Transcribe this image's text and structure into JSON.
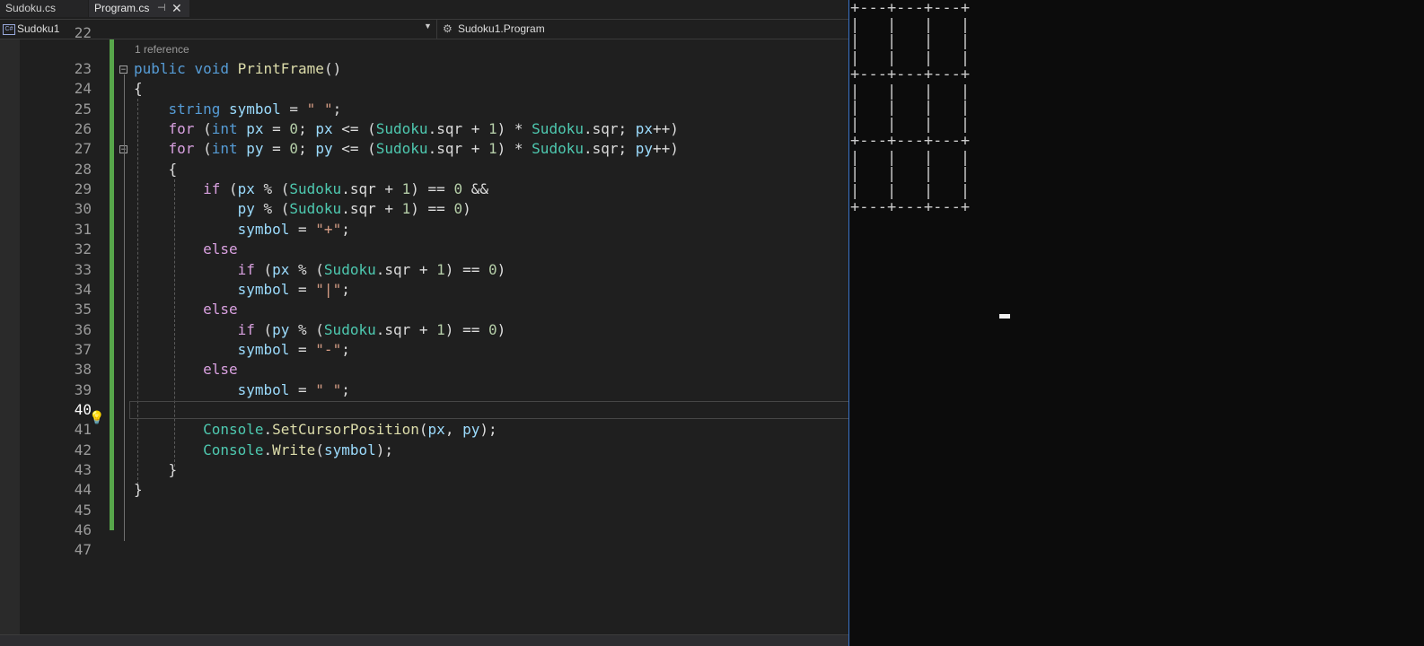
{
  "tabs": [
    {
      "label": "Sudoku.cs",
      "active": false
    },
    {
      "label": "Program.cs",
      "active": true
    }
  ],
  "navbar": {
    "project": "Sudoku1",
    "project_icon": "csharp-project-icon",
    "member": "Sudoku1.Program",
    "member_icon": "class-icon"
  },
  "codelens": "1 reference",
  "line_numbers": [
    "22",
    "23",
    "24",
    "25",
    "26",
    "27",
    "28",
    "29",
    "30",
    "31",
    "32",
    "33",
    "34",
    "35",
    "36",
    "37",
    "38",
    "39",
    "40",
    "41",
    "42",
    "43",
    "44",
    "45",
    "46",
    "47"
  ],
  "current_line": "40",
  "code_lines": [
    {
      "ln": "23",
      "segs": [
        [
          "kw",
          "public"
        ],
        [
          "pun",
          " "
        ],
        [
          "kw",
          "void"
        ],
        [
          "pun",
          " "
        ],
        [
          "fn",
          "PrintFrame"
        ],
        [
          "pun",
          "()"
        ]
      ]
    },
    {
      "ln": "24",
      "segs": [
        [
          "pun",
          "{"
        ]
      ]
    },
    {
      "ln": "25",
      "segs": [
        [
          "pun",
          "    "
        ],
        [
          "kw",
          "string"
        ],
        [
          "pun",
          " "
        ],
        [
          "var",
          "symbol"
        ],
        [
          "pun",
          " = "
        ],
        [
          "str",
          "\" \""
        ],
        [
          "pun",
          ";"
        ]
      ]
    },
    {
      "ln": "26",
      "segs": [
        [
          "pun",
          "    "
        ],
        [
          "ctl",
          "for"
        ],
        [
          "pun",
          " ("
        ],
        [
          "kw",
          "int"
        ],
        [
          "pun",
          " "
        ],
        [
          "var",
          "px"
        ],
        [
          "pun",
          " = "
        ],
        [
          "num",
          "0"
        ],
        [
          "pun",
          "; "
        ],
        [
          "var",
          "px"
        ],
        [
          "pun",
          " <= ("
        ],
        [
          "ty",
          "Sudoku"
        ],
        [
          "pun",
          "."
        ],
        [
          "pun",
          "sqr + "
        ],
        [
          "num",
          "1"
        ],
        [
          "pun",
          ") * "
        ],
        [
          "ty",
          "Sudoku"
        ],
        [
          "pun",
          ".sqr; "
        ],
        [
          "var",
          "px"
        ],
        [
          "pun",
          "++)"
        ]
      ]
    },
    {
      "ln": "27",
      "segs": [
        [
          "pun",
          "    "
        ],
        [
          "ctl",
          "for"
        ],
        [
          "pun",
          " ("
        ],
        [
          "kw",
          "int"
        ],
        [
          "pun",
          " "
        ],
        [
          "var",
          "py"
        ],
        [
          "pun",
          " = "
        ],
        [
          "num",
          "0"
        ],
        [
          "pun",
          "; "
        ],
        [
          "var",
          "py"
        ],
        [
          "pun",
          " <= ("
        ],
        [
          "ty",
          "Sudoku"
        ],
        [
          "pun",
          "."
        ],
        [
          "pun",
          "sqr + "
        ],
        [
          "num",
          "1"
        ],
        [
          "pun",
          ") * "
        ],
        [
          "ty",
          "Sudoku"
        ],
        [
          "pun",
          ".sqr; "
        ],
        [
          "var",
          "py"
        ],
        [
          "pun",
          "++)"
        ]
      ]
    },
    {
      "ln": "28",
      "segs": [
        [
          "pun",
          "    {"
        ]
      ]
    },
    {
      "ln": "29",
      "segs": [
        [
          "pun",
          "        "
        ],
        [
          "ctl",
          "if"
        ],
        [
          "pun",
          " ("
        ],
        [
          "var",
          "px"
        ],
        [
          "pun",
          " % ("
        ],
        [
          "ty",
          "Sudoku"
        ],
        [
          "pun",
          ".sqr + "
        ],
        [
          "num",
          "1"
        ],
        [
          "pun",
          ") == "
        ],
        [
          "num",
          "0"
        ],
        [
          "pun",
          " &&"
        ]
      ]
    },
    {
      "ln": "30",
      "segs": [
        [
          "pun",
          "            "
        ],
        [
          "var",
          "py"
        ],
        [
          "pun",
          " % ("
        ],
        [
          "ty",
          "Sudoku"
        ],
        [
          "pun",
          ".sqr + "
        ],
        [
          "num",
          "1"
        ],
        [
          "pun",
          ") == "
        ],
        [
          "num",
          "0"
        ],
        [
          "pun",
          ")"
        ]
      ]
    },
    {
      "ln": "31",
      "segs": [
        [
          "pun",
          "            "
        ],
        [
          "var",
          "symbol"
        ],
        [
          "pun",
          " = "
        ],
        [
          "str",
          "\"+\""
        ],
        [
          "pun",
          ";"
        ]
      ]
    },
    {
      "ln": "32",
      "segs": [
        [
          "pun",
          "        "
        ],
        [
          "ctl",
          "else"
        ]
      ]
    },
    {
      "ln": "33",
      "segs": [
        [
          "pun",
          "            "
        ],
        [
          "ctl",
          "if"
        ],
        [
          "pun",
          " ("
        ],
        [
          "var",
          "px"
        ],
        [
          "pun",
          " % ("
        ],
        [
          "ty",
          "Sudoku"
        ],
        [
          "pun",
          ".sqr + "
        ],
        [
          "num",
          "1"
        ],
        [
          "pun",
          ") == "
        ],
        [
          "num",
          "0"
        ],
        [
          "pun",
          ")"
        ]
      ]
    },
    {
      "ln": "34",
      "segs": [
        [
          "pun",
          "            "
        ],
        [
          "var",
          "symbol"
        ],
        [
          "pun",
          " = "
        ],
        [
          "str",
          "\"|\""
        ],
        [
          "pun",
          ";"
        ]
      ]
    },
    {
      "ln": "35",
      "segs": [
        [
          "pun",
          "        "
        ],
        [
          "ctl",
          "else"
        ]
      ]
    },
    {
      "ln": "36",
      "segs": [
        [
          "pun",
          "            "
        ],
        [
          "ctl",
          "if"
        ],
        [
          "pun",
          " ("
        ],
        [
          "var",
          "py"
        ],
        [
          "pun",
          " % ("
        ],
        [
          "ty",
          "Sudoku"
        ],
        [
          "pun",
          ".sqr + "
        ],
        [
          "num",
          "1"
        ],
        [
          "pun",
          ") == "
        ],
        [
          "num",
          "0"
        ],
        [
          "pun",
          ")"
        ]
      ]
    },
    {
      "ln": "37",
      "segs": [
        [
          "pun",
          "            "
        ],
        [
          "var",
          "symbol"
        ],
        [
          "pun",
          " = "
        ],
        [
          "str",
          "\"-\""
        ],
        [
          "pun",
          ";"
        ]
      ]
    },
    {
      "ln": "38",
      "segs": [
        [
          "pun",
          "        "
        ],
        [
          "ctl",
          "else"
        ]
      ]
    },
    {
      "ln": "39",
      "segs": [
        [
          "pun",
          "            "
        ],
        [
          "var",
          "symbol"
        ],
        [
          "pun",
          " = "
        ],
        [
          "str",
          "\" \""
        ],
        [
          "pun",
          ";"
        ]
      ]
    },
    {
      "ln": "40",
      "segs": []
    },
    {
      "ln": "41",
      "segs": [
        [
          "pun",
          "        "
        ],
        [
          "ty",
          "Console"
        ],
        [
          "pun",
          "."
        ],
        [
          "fn",
          "SetCursorPosition"
        ],
        [
          "pun",
          "("
        ],
        [
          "var",
          "px"
        ],
        [
          "pun",
          ", "
        ],
        [
          "var",
          "py"
        ],
        [
          "pun",
          ");"
        ]
      ]
    },
    {
      "ln": "42",
      "segs": [
        [
          "pun",
          "        "
        ],
        [
          "ty",
          "Console"
        ],
        [
          "pun",
          "."
        ],
        [
          "fn",
          "Write"
        ],
        [
          "pun",
          "("
        ],
        [
          "var",
          "symbol"
        ],
        [
          "pun",
          ");"
        ]
      ]
    },
    {
      "ln": "43",
      "segs": [
        [
          "pun",
          "    }"
        ]
      ]
    },
    {
      "ln": "44",
      "segs": [
        [
          "pun",
          "}"
        ]
      ]
    },
    {
      "ln": "45",
      "segs": []
    },
    {
      "ln": "46",
      "segs": []
    },
    {
      "ln": "47",
      "segs": []
    }
  ],
  "console_lines": [
    "+---+---+---+",
    "|   |   |   |",
    "|   |   |   |",
    "|   |   |   |",
    "+---+---+---+",
    "|   |   |   |",
    "|   |   |   |",
    "|   |   |   |",
    "+---+---+---+",
    "|   |   |   |",
    "|   |   |   |",
    "|   |   |   |",
    "+---+---+---+"
  ],
  "colors": {
    "keyword": "#569cd6",
    "control": "#d8a0df",
    "method": "#dcdcaa",
    "type": "#4ec9b0",
    "variable": "#9cdcfe",
    "number": "#b5cea8",
    "string": "#d69d85",
    "changebar": "#57a64a"
  }
}
